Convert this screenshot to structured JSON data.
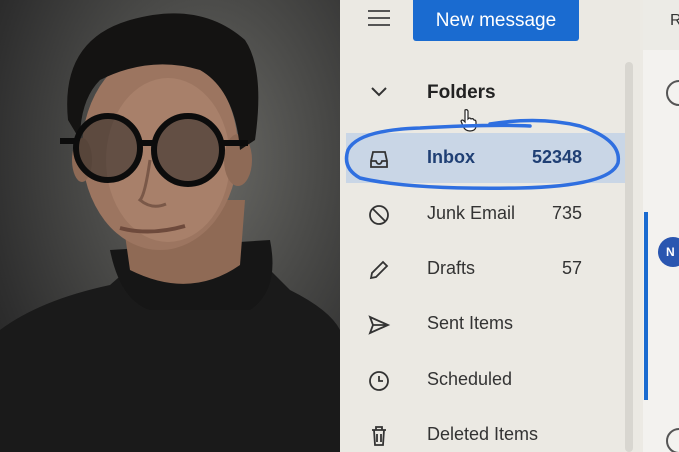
{
  "header": {
    "new_message_label": "New message",
    "right_cut_text": "R"
  },
  "folders": {
    "label": "Folders"
  },
  "items": [
    {
      "label": "Inbox",
      "count": "52348",
      "icon": "inbox-tray-icon",
      "selected": true
    },
    {
      "label": "Junk Email",
      "count": "735",
      "icon": "block-icon"
    },
    {
      "label": "Drafts",
      "count": "57",
      "icon": "pencil-icon"
    },
    {
      "label": "Sent Items",
      "count": "",
      "icon": "send-icon"
    },
    {
      "label": "Scheduled",
      "count": "",
      "icon": "clock-icon"
    },
    {
      "label": "Deleted Items",
      "count": "",
      "icon": "trash-icon"
    }
  ],
  "reading_pane": {
    "avatar_initial": "N"
  },
  "colors": {
    "accent": "#1a6bd0",
    "selected_bg": "#c9d6e6",
    "highlight_circle": "#2f6fe0"
  }
}
